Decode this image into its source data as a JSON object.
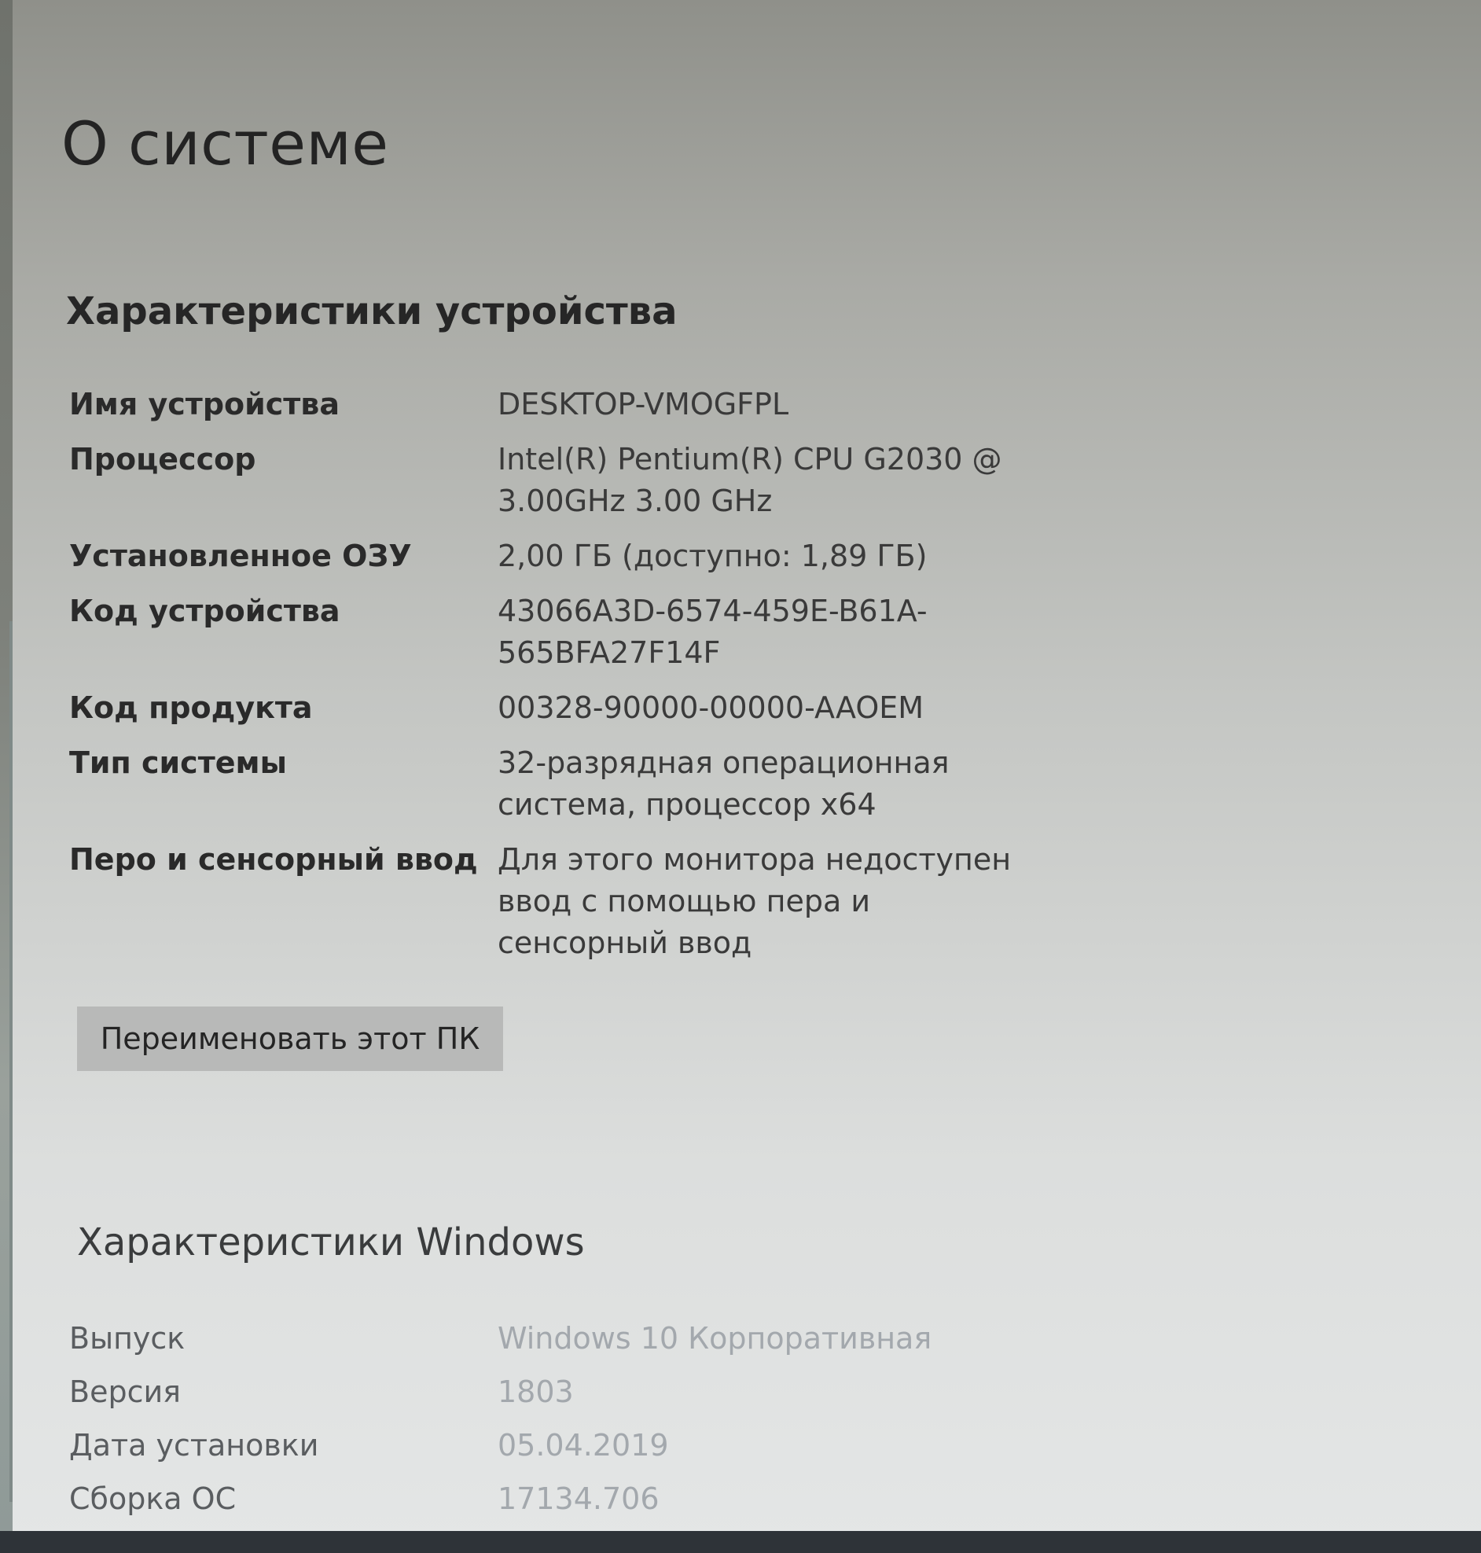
{
  "page": {
    "title": "О системе"
  },
  "device_specs": {
    "title": "Характеристики устройства",
    "rows": [
      {
        "label": "Имя устройства",
        "value": "DESKTOP-VMOGFPL"
      },
      {
        "label": "Процессор",
        "value": "Intel(R) Pentium(R) CPU G2030 @ 3.00GHz   3.00 GHz"
      },
      {
        "label": "Установленное ОЗУ",
        "value": "2,00 ГБ (доступно: 1,89 ГБ)"
      },
      {
        "label": "Код устройства",
        "value": "43066A3D-6574-459E-B61A-565BFA27F14F"
      },
      {
        "label": "Код продукта",
        "value": "00328-90000-00000-AAOEM"
      },
      {
        "label": "Тип системы",
        "value": "32-разрядная операционная система, процессор x64"
      },
      {
        "label": "Перо и сенсорный ввод",
        "value": "Для этого монитора недоступен ввод с помощью пера и сенсорный ввод"
      }
    ],
    "rename_button": "Переименовать этот ПК"
  },
  "windows_specs": {
    "title": "Характеристики Windows",
    "rows": [
      {
        "label": "Выпуск",
        "value": "Windows 10 Корпоративная"
      },
      {
        "label": "Версия",
        "value": "1803"
      },
      {
        "label": "Дата установки",
        "value": "05.04.2019"
      },
      {
        "label": "Сборка ОС",
        "value": "17134.706"
      }
    ]
  }
}
